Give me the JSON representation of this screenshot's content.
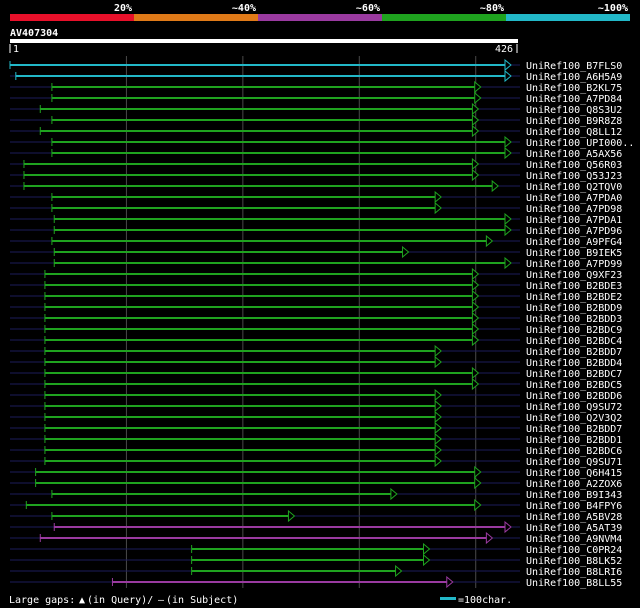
{
  "colors": {
    "background": "#000000",
    "band_red": "#e8102a",
    "band_orange": "#e07a18",
    "band_purple": "#9a3aa0",
    "band_green": "#1fa31f",
    "band_cyan": "#22b8c8",
    "track": "#1c1c5a",
    "grid": "#4a4a4a",
    "text": "#ffffff"
  },
  "legend": {
    "bands": [
      {
        "label": "20%",
        "color": "#e8102a"
      },
      {
        "label": "~40%",
        "color": "#e07a18"
      },
      {
        "label": "~60%",
        "color": "#9a3aa0"
      },
      {
        "label": "~80%",
        "color": "#1fa31f"
      },
      {
        "label": "~100%",
        "color": "#22b8c8"
      }
    ]
  },
  "query": {
    "id": "AV407304",
    "start_label": "1",
    "end_label": "426",
    "length": 426
  },
  "footer": {
    "gaps_label": "Large gaps:",
    "query_gap_symbol": "▲",
    "query_gap_text": "(in Query)/",
    "subject_gap_symbol": "–",
    "subject_gap_text": "(in Subject)",
    "scale_label": "=100char.",
    "scale_color": "#22b8c8"
  },
  "hits": [
    {
      "name": "UniRef100_B7FLS0",
      "start": 0,
      "end": 426,
      "class": "cyan"
    },
    {
      "name": "UniRef100_A6H5A9",
      "start": 5,
      "end": 426,
      "class": "cyan"
    },
    {
      "name": "UniRef100_B2KL75",
      "start": 36,
      "end": 400,
      "class": "green"
    },
    {
      "name": "UniRef100_A7PD84",
      "start": 36,
      "end": 400,
      "class": "green"
    },
    {
      "name": "UniRef100_Q8S3U2",
      "start": 26,
      "end": 398,
      "class": "green"
    },
    {
      "name": "UniRef100_B9R8Z8",
      "start": 36,
      "end": 398,
      "class": "green"
    },
    {
      "name": "UniRef100_Q8LL12",
      "start": 26,
      "end": 398,
      "class": "green"
    },
    {
      "name": "UniRef100_UPI000..",
      "start": 36,
      "end": 426,
      "class": "green"
    },
    {
      "name": "UniRef100_A5AX56",
      "start": 36,
      "end": 426,
      "class": "green"
    },
    {
      "name": "UniRef100_Q56R03",
      "start": 12,
      "end": 398,
      "class": "green"
    },
    {
      "name": "UniRef100_Q53J23",
      "start": 12,
      "end": 398,
      "class": "green"
    },
    {
      "name": "UniRef100_Q2TQV0",
      "start": 12,
      "end": 415,
      "class": "green"
    },
    {
      "name": "UniRef100_A7PDA0",
      "start": 36,
      "end": 366,
      "class": "green"
    },
    {
      "name": "UniRef100_A7PD98",
      "start": 36,
      "end": 366,
      "class": "green"
    },
    {
      "name": "UniRef100_A7PDA1",
      "start": 38,
      "end": 426,
      "class": "green"
    },
    {
      "name": "UniRef100_A7PD96",
      "start": 38,
      "end": 426,
      "class": "green"
    },
    {
      "name": "UniRef100_A9PFG4",
      "start": 36,
      "end": 410,
      "class": "green"
    },
    {
      "name": "UniRef100_B9IEK5",
      "start": 38,
      "end": 338,
      "class": "green"
    },
    {
      "name": "UniRef100_A7PD99",
      "start": 38,
      "end": 426,
      "class": "green"
    },
    {
      "name": "UniRef100_Q9XF23",
      "start": 30,
      "end": 398,
      "class": "green"
    },
    {
      "name": "UniRef100_B2BDE3",
      "start": 30,
      "end": 398,
      "class": "green"
    },
    {
      "name": "UniRef100_B2BDE2",
      "start": 30,
      "end": 398,
      "class": "green"
    },
    {
      "name": "UniRef100_B2BDD9",
      "start": 30,
      "end": 398,
      "class": "green"
    },
    {
      "name": "UniRef100_B2BDD3",
      "start": 30,
      "end": 398,
      "class": "green"
    },
    {
      "name": "UniRef100_B2BDC9",
      "start": 30,
      "end": 398,
      "class": "green"
    },
    {
      "name": "UniRef100_B2BDC4",
      "start": 30,
      "end": 398,
      "class": "green"
    },
    {
      "name": "UniRef100_B2BDD7",
      "start": 30,
      "end": 366,
      "class": "green"
    },
    {
      "name": "UniRef100_B2BDD4",
      "start": 30,
      "end": 366,
      "class": "green"
    },
    {
      "name": "UniRef100_B2BDC7",
      "start": 30,
      "end": 398,
      "class": "green"
    },
    {
      "name": "UniRef100_B2BDC5",
      "start": 30,
      "end": 398,
      "class": "green"
    },
    {
      "name": "UniRef100_B2BDD6",
      "start": 30,
      "end": 366,
      "class": "green"
    },
    {
      "name": "UniRef100_Q9SU72",
      "start": 30,
      "end": 366,
      "class": "green"
    },
    {
      "name": "UniRef100_Q2V3Q2",
      "start": 30,
      "end": 366,
      "class": "green"
    },
    {
      "name": "UniRef100_B2BDD7",
      "start": 30,
      "end": 366,
      "class": "green"
    },
    {
      "name": "UniRef100_B2BDD1",
      "start": 30,
      "end": 366,
      "class": "green"
    },
    {
      "name": "UniRef100_B2BDC6",
      "start": 30,
      "end": 366,
      "class": "green"
    },
    {
      "name": "UniRef100_Q9SU71",
      "start": 30,
      "end": 366,
      "class": "green"
    },
    {
      "name": "UniRef100_Q6H415",
      "start": 22,
      "end": 400,
      "class": "green"
    },
    {
      "name": "UniRef100_A2ZOX6",
      "start": 22,
      "end": 400,
      "class": "green"
    },
    {
      "name": "UniRef100_B9I343",
      "start": 36,
      "end": 328,
      "class": "green"
    },
    {
      "name": "UniRef100_B4FPY6",
      "start": 14,
      "end": 400,
      "class": "green"
    },
    {
      "name": "UniRef100_A5BV28",
      "start": 36,
      "end": 240,
      "class": "green"
    },
    {
      "name": "UniRef100_A5AT39",
      "start": 38,
      "end": 426,
      "class": "purple"
    },
    {
      "name": "UniRef100_A9NVM4",
      "start": 26,
      "end": 410,
      "class": "purple"
    },
    {
      "name": "UniRef100_C0PR24",
      "start": 156,
      "end": 356,
      "class": "green"
    },
    {
      "name": "UniRef100_B8LK52",
      "start": 156,
      "end": 356,
      "class": "green"
    },
    {
      "name": "UniRef100_B8LRI6",
      "start": 156,
      "end": 332,
      "class": "green"
    },
    {
      "name": "UniRef100_B8LL55",
      "start": 88,
      "end": 376,
      "class": "purple"
    }
  ]
}
